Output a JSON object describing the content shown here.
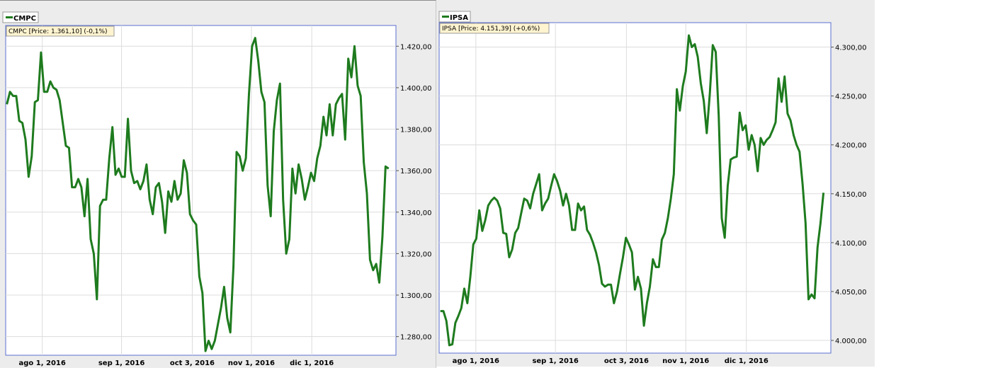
{
  "chart_data": [
    {
      "type": "line",
      "legend": "CMPC",
      "info": "CMPC [Price: 1.361,10] (-0,1%)",
      "color": "#1e7b1e",
      "x_ticks": [
        "ago 1, 2016",
        "sep 1, 2016",
        "oct 3, 2016",
        "nov 1, 2016",
        "dic 1, 2016"
      ],
      "y_ticks": [
        "1.280,00",
        "1.300,00",
        "1.320,00",
        "1.340,00",
        "1.360,00",
        "1.380,00",
        "1.400,00",
        "1.420,00"
      ],
      "y_tick_values": [
        1280,
        1300,
        1320,
        1340,
        1360,
        1380,
        1400,
        1420
      ],
      "ylim": [
        1271,
        1430
      ],
      "xlim": [
        0,
        64
      ],
      "x_tick_positions": [
        6,
        19,
        30.6,
        40.3,
        50.2
      ],
      "series": [
        {
          "values": [
            1392,
            1398,
            1396,
            1396,
            1384,
            1383,
            1375,
            1357,
            1367,
            1393,
            1394,
            1417,
            1398,
            1398,
            1403,
            1400,
            1399,
            1394,
            1383,
            1372,
            1371,
            1352,
            1352,
            1356,
            1352,
            1338,
            1356,
            1327,
            1320,
            1298,
            1343,
            1346,
            1346,
            1366,
            1381,
            1358,
            1361,
            1357,
            1357,
            1385,
            1360,
            1354,
            1355,
            1351,
            1355,
            1363,
            1346,
            1339,
            1352,
            1354,
            1345,
            1330,
            1350,
            1345,
            1355,
            1346,
            1349,
            1365,
            1359,
            1339,
            1336,
            1334,
            1309,
            1301,
            1273,
            1278,
            1274,
            1278,
            1286,
            1294,
            1304,
            1289,
            1282,
            1314,
            1369,
            1367,
            1360,
            1366,
            1397,
            1420,
            1424,
            1413,
            1398,
            1393,
            1353,
            1338,
            1379,
            1394,
            1402,
            1346,
            1320,
            1327,
            1361,
            1349,
            1363,
            1356,
            1346,
            1352,
            1359,
            1355,
            1366,
            1372,
            1386,
            1377,
            1392,
            1377,
            1392,
            1395,
            1397,
            1375,
            1414,
            1405,
            1420,
            1401,
            1396,
            1364,
            1349,
            1317,
            1312,
            1315,
            1306,
            1328,
            1362,
            1361
          ]
        }
      ]
    },
    {
      "type": "line",
      "legend": "IPSA",
      "info": "IPSA [Price: 4.151,39] (+0,6%)",
      "color": "#1e7b1e",
      "x_ticks": [
        "ago 1, 2016",
        "sep 1, 2016",
        "oct 3, 2016",
        "nov 1, 2016",
        "dic 1, 2016"
      ],
      "y_ticks": [
        "4.000,00",
        "4.050,00",
        "4.100,00",
        "4.150,00",
        "4.200,00",
        "4.250,00",
        "4.300,00"
      ],
      "y_tick_values": [
        4000,
        4050,
        4100,
        4150,
        4200,
        4250,
        4300
      ],
      "ylim": [
        3987,
        4325
      ],
      "xlim": [
        0,
        64
      ],
      "x_tick_positions": [
        6,
        19,
        30.6,
        40.3,
        50.2
      ],
      "series": [
        {
          "values": [
            4030,
            4030,
            4020,
            3995,
            3996,
            4018,
            4025,
            4033,
            4053,
            4038,
            4065,
            4098,
            4104,
            4133,
            4112,
            4123,
            4138,
            4143,
            4146,
            4143,
            4135,
            4110,
            4109,
            4085,
            4093,
            4110,
            4115,
            4130,
            4145,
            4143,
            4135,
            4150,
            4160,
            4170,
            4133,
            4140,
            4145,
            4158,
            4170,
            4163,
            4153,
            4138,
            4150,
            4138,
            4113,
            4113,
            4140,
            4133,
            4137,
            4113,
            4108,
            4100,
            4090,
            4077,
            4058,
            4055,
            4057,
            4057,
            4038,
            4050,
            4068,
            4085,
            4105,
            4098,
            4090,
            4052,
            4065,
            4053,
            4015,
            4038,
            4055,
            4083,
            4075,
            4075,
            4103,
            4110,
            4125,
            4145,
            4170,
            4257,
            4235,
            4260,
            4275,
            4312,
            4300,
            4303,
            4290,
            4263,
            4245,
            4212,
            4252,
            4302,
            4295,
            4230,
            4125,
            4105,
            4158,
            4185,
            4187,
            4188,
            4233,
            4215,
            4220,
            4195,
            4210,
            4200,
            4173,
            4207,
            4200,
            4205,
            4208,
            4215,
            4223,
            4268,
            4244,
            4270,
            4232,
            4225,
            4210,
            4200,
            4193,
            4160,
            4120,
            4042,
            4047,
            4043,
            4095,
            4120,
            4151
          ]
        }
      ]
    }
  ]
}
